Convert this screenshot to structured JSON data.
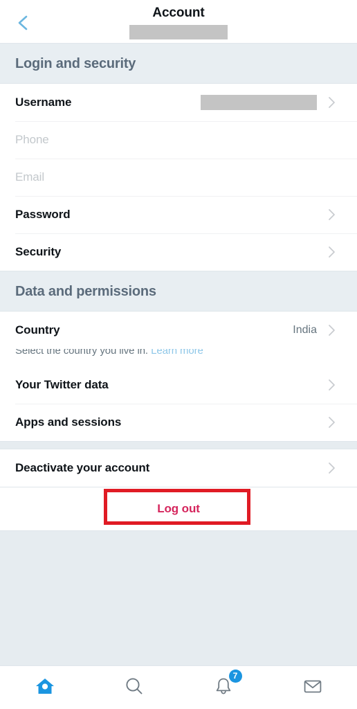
{
  "header": {
    "back_icon": "chevron-left-icon",
    "title": "Account",
    "redacted_handle": ""
  },
  "sections": [
    {
      "title": "Login and security",
      "rows": [
        {
          "label": "Username",
          "value": "",
          "redacted_value": true,
          "chevron": true,
          "muted": false
        },
        {
          "label": "Phone",
          "value": "",
          "redacted_value": false,
          "chevron": false,
          "muted": true
        },
        {
          "label": "Email",
          "value": "",
          "redacted_value": false,
          "chevron": false,
          "muted": true
        },
        {
          "label": "Password",
          "value": "",
          "redacted_value": false,
          "chevron": true,
          "muted": false
        },
        {
          "label": "Security",
          "value": "",
          "redacted_value": false,
          "chevron": true,
          "muted": false
        }
      ]
    },
    {
      "title": "Data and permissions",
      "rows": [
        {
          "label": "Country",
          "value": "India",
          "redacted_value": false,
          "chevron": true,
          "muted": false
        },
        {
          "label": "Your Twitter data",
          "value": "",
          "redacted_value": false,
          "chevron": true,
          "muted": false
        },
        {
          "label": "Apps and sessions",
          "value": "",
          "redacted_value": false,
          "chevron": true,
          "muted": false
        }
      ]
    }
  ],
  "country_help": {
    "text": "Select the country you live in.",
    "link_label": "Learn more"
  },
  "deactivate": {
    "label": "Deactivate your account",
    "chevron": true
  },
  "logout": {
    "label": "Log out",
    "color": "#d5255c",
    "annotation_color": "#e01b24"
  },
  "bottom_nav": [
    {
      "name": "home",
      "icon": "home-icon",
      "active": true,
      "badge": ""
    },
    {
      "name": "search",
      "icon": "search-icon",
      "active": false,
      "badge": ""
    },
    {
      "name": "notifications",
      "icon": "bell-icon",
      "active": false,
      "badge": "7"
    },
    {
      "name": "messages",
      "icon": "envelope-icon",
      "active": false,
      "badge": ""
    }
  ],
  "colors": {
    "accent": "#1b95e0",
    "section_bg": "#e8eef2",
    "page_bg": "#e6ecf0",
    "muted_text": "#c3c8cc",
    "value_text": "#66757f",
    "link": "#8ec7e8"
  }
}
